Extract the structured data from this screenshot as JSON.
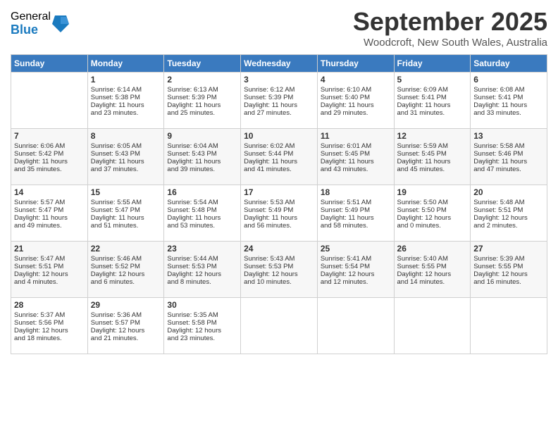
{
  "logo": {
    "general": "General",
    "blue": "Blue"
  },
  "title": "September 2025",
  "subtitle": "Woodcroft, New South Wales, Australia",
  "weekdays": [
    "Sunday",
    "Monday",
    "Tuesday",
    "Wednesday",
    "Thursday",
    "Friday",
    "Saturday"
  ],
  "weeks": [
    [
      {
        "day": "",
        "info": ""
      },
      {
        "day": "1",
        "info": "Sunrise: 6:14 AM\nSunset: 5:38 PM\nDaylight: 11 hours\nand 23 minutes."
      },
      {
        "day": "2",
        "info": "Sunrise: 6:13 AM\nSunset: 5:39 PM\nDaylight: 11 hours\nand 25 minutes."
      },
      {
        "day": "3",
        "info": "Sunrise: 6:12 AM\nSunset: 5:39 PM\nDaylight: 11 hours\nand 27 minutes."
      },
      {
        "day": "4",
        "info": "Sunrise: 6:10 AM\nSunset: 5:40 PM\nDaylight: 11 hours\nand 29 minutes."
      },
      {
        "day": "5",
        "info": "Sunrise: 6:09 AM\nSunset: 5:41 PM\nDaylight: 11 hours\nand 31 minutes."
      },
      {
        "day": "6",
        "info": "Sunrise: 6:08 AM\nSunset: 5:41 PM\nDaylight: 11 hours\nand 33 minutes."
      }
    ],
    [
      {
        "day": "7",
        "info": "Sunrise: 6:06 AM\nSunset: 5:42 PM\nDaylight: 11 hours\nand 35 minutes."
      },
      {
        "day": "8",
        "info": "Sunrise: 6:05 AM\nSunset: 5:43 PM\nDaylight: 11 hours\nand 37 minutes."
      },
      {
        "day": "9",
        "info": "Sunrise: 6:04 AM\nSunset: 5:43 PM\nDaylight: 11 hours\nand 39 minutes."
      },
      {
        "day": "10",
        "info": "Sunrise: 6:02 AM\nSunset: 5:44 PM\nDaylight: 11 hours\nand 41 minutes."
      },
      {
        "day": "11",
        "info": "Sunrise: 6:01 AM\nSunset: 5:45 PM\nDaylight: 11 hours\nand 43 minutes."
      },
      {
        "day": "12",
        "info": "Sunrise: 5:59 AM\nSunset: 5:45 PM\nDaylight: 11 hours\nand 45 minutes."
      },
      {
        "day": "13",
        "info": "Sunrise: 5:58 AM\nSunset: 5:46 PM\nDaylight: 11 hours\nand 47 minutes."
      }
    ],
    [
      {
        "day": "14",
        "info": "Sunrise: 5:57 AM\nSunset: 5:47 PM\nDaylight: 11 hours\nand 49 minutes."
      },
      {
        "day": "15",
        "info": "Sunrise: 5:55 AM\nSunset: 5:47 PM\nDaylight: 11 hours\nand 51 minutes."
      },
      {
        "day": "16",
        "info": "Sunrise: 5:54 AM\nSunset: 5:48 PM\nDaylight: 11 hours\nand 53 minutes."
      },
      {
        "day": "17",
        "info": "Sunrise: 5:53 AM\nSunset: 5:49 PM\nDaylight: 11 hours\nand 56 minutes."
      },
      {
        "day": "18",
        "info": "Sunrise: 5:51 AM\nSunset: 5:49 PM\nDaylight: 11 hours\nand 58 minutes."
      },
      {
        "day": "19",
        "info": "Sunrise: 5:50 AM\nSunset: 5:50 PM\nDaylight: 12 hours\nand 0 minutes."
      },
      {
        "day": "20",
        "info": "Sunrise: 5:48 AM\nSunset: 5:51 PM\nDaylight: 12 hours\nand 2 minutes."
      }
    ],
    [
      {
        "day": "21",
        "info": "Sunrise: 5:47 AM\nSunset: 5:51 PM\nDaylight: 12 hours\nand 4 minutes."
      },
      {
        "day": "22",
        "info": "Sunrise: 5:46 AM\nSunset: 5:52 PM\nDaylight: 12 hours\nand 6 minutes."
      },
      {
        "day": "23",
        "info": "Sunrise: 5:44 AM\nSunset: 5:53 PM\nDaylight: 12 hours\nand 8 minutes."
      },
      {
        "day": "24",
        "info": "Sunrise: 5:43 AM\nSunset: 5:53 PM\nDaylight: 12 hours\nand 10 minutes."
      },
      {
        "day": "25",
        "info": "Sunrise: 5:41 AM\nSunset: 5:54 PM\nDaylight: 12 hours\nand 12 minutes."
      },
      {
        "day": "26",
        "info": "Sunrise: 5:40 AM\nSunset: 5:55 PM\nDaylight: 12 hours\nand 14 minutes."
      },
      {
        "day": "27",
        "info": "Sunrise: 5:39 AM\nSunset: 5:55 PM\nDaylight: 12 hours\nand 16 minutes."
      }
    ],
    [
      {
        "day": "28",
        "info": "Sunrise: 5:37 AM\nSunset: 5:56 PM\nDaylight: 12 hours\nand 18 minutes."
      },
      {
        "day": "29",
        "info": "Sunrise: 5:36 AM\nSunset: 5:57 PM\nDaylight: 12 hours\nand 21 minutes."
      },
      {
        "day": "30",
        "info": "Sunrise: 5:35 AM\nSunset: 5:58 PM\nDaylight: 12 hours\nand 23 minutes."
      },
      {
        "day": "",
        "info": ""
      },
      {
        "day": "",
        "info": ""
      },
      {
        "day": "",
        "info": ""
      },
      {
        "day": "",
        "info": ""
      }
    ]
  ]
}
